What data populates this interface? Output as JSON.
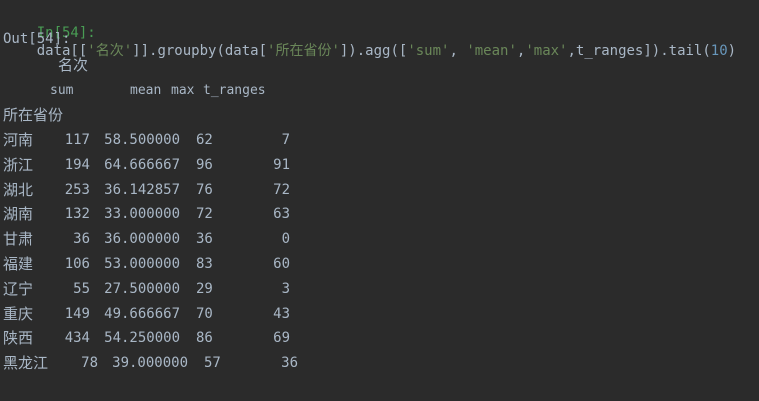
{
  "input": {
    "prompt": "In[54]:",
    "code_parts": [
      {
        "t": "data[[",
        "k": "code"
      },
      {
        "t": "'名次'",
        "k": "str"
      },
      {
        "t": "]].groupby(data[",
        "k": "code"
      },
      {
        "t": "'所在省份'",
        "k": "str"
      },
      {
        "t": "]).agg([",
        "k": "code"
      },
      {
        "t": "'sum'",
        "k": "str"
      },
      {
        "t": ", ",
        "k": "code"
      },
      {
        "t": "'mean'",
        "k": "str"
      },
      {
        "t": ",",
        "k": "code"
      },
      {
        "t": "'max'",
        "k": "str"
      },
      {
        "t": ",t_ranges]).tail(",
        "k": "code"
      },
      {
        "t": "10",
        "k": "num"
      },
      {
        "t": ")",
        "k": "code"
      }
    ]
  },
  "output": {
    "prompt": "Out[54]:",
    "top_header": "名次",
    "columns": [
      "sum",
      "mean",
      "max",
      "t_ranges"
    ],
    "index_name": "所在省份",
    "rows": [
      {
        "province": "河南",
        "sum": "117",
        "mean": "58.500000",
        "max": "62",
        "t_ranges": "7"
      },
      {
        "province": "浙江",
        "sum": "194",
        "mean": "64.666667",
        "max": "96",
        "t_ranges": "91"
      },
      {
        "province": "湖北",
        "sum": "253",
        "mean": "36.142857",
        "max": "76",
        "t_ranges": "72"
      },
      {
        "province": "湖南",
        "sum": "132",
        "mean": "33.000000",
        "max": "72",
        "t_ranges": "63"
      },
      {
        "province": "甘肃",
        "sum": "36",
        "mean": "36.000000",
        "max": "36",
        "t_ranges": "0"
      },
      {
        "province": "福建",
        "sum": "106",
        "mean": "53.000000",
        "max": "83",
        "t_ranges": "60"
      },
      {
        "province": "辽宁",
        "sum": "55",
        "mean": "27.500000",
        "max": "29",
        "t_ranges": "3"
      },
      {
        "province": "重庆",
        "sum": "149",
        "mean": "49.666667",
        "max": "70",
        "t_ranges": "43"
      },
      {
        "province": "陕西",
        "sum": "434",
        "mean": "54.250000",
        "max": "86",
        "t_ranges": "69"
      },
      {
        "province": "黑龙江",
        "sum": "78",
        "mean": "39.000000",
        "max": "57",
        "t_ranges": "36"
      }
    ]
  }
}
